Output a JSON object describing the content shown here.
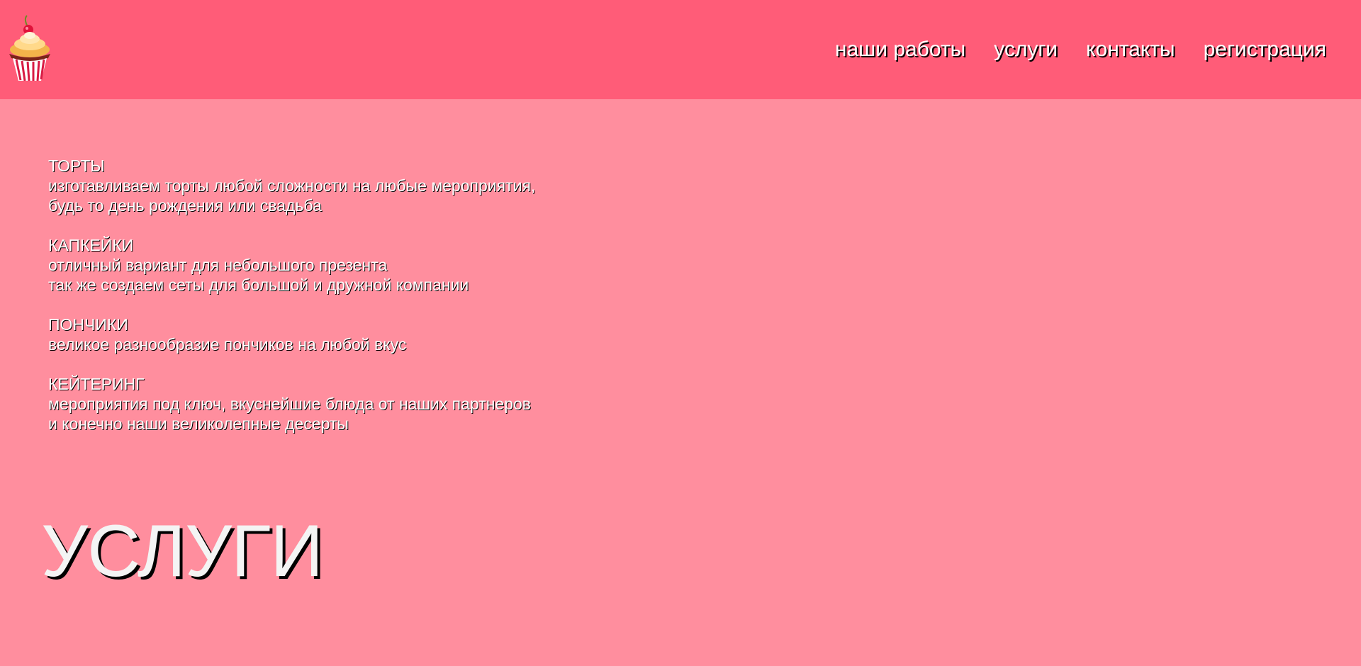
{
  "header": {
    "logo_icon": "cupcake-icon",
    "nav": [
      {
        "label": "наши работы"
      },
      {
        "label": "услуги"
      },
      {
        "label": "контакты"
      },
      {
        "label": "регистрация"
      }
    ]
  },
  "services": [
    {
      "title": "ТОРТЫ",
      "lines": [
        "изготавливаем торты любой сложности на любые мероприятия,",
        "будь то день рождения или свадьба"
      ]
    },
    {
      "title": "КАПКЕЙКИ",
      "lines": [
        "отличный вариант для небольшого презента",
        "так же создаем сеты для большой и дружной компании"
      ]
    },
    {
      "title": "ПОНЧИКИ",
      "lines": [
        "великое разнообразие пончиков на любой вкус"
      ]
    },
    {
      "title": "КЕЙТЕРИНГ",
      "lines": [
        "мероприятия под ключ, вкуснейшие блюда от наших партнеров",
        "и конечно наши великолепные десерты"
      ]
    }
  ],
  "page_heading": "УСЛУГИ",
  "colors": {
    "header_bg": "#ff5c78",
    "page_bg": "#ff8e9e",
    "text": "#ffffff",
    "shadow": "#000000"
  }
}
